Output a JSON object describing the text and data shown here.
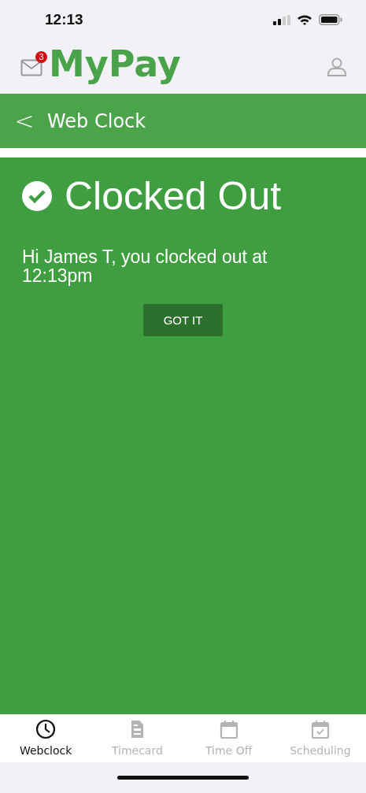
{
  "status_bar": {
    "time": "12:13"
  },
  "header": {
    "logo": "MyPay",
    "mail_badge": "3"
  },
  "nav_bar": {
    "back": "<",
    "title": "Web Clock"
  },
  "notice": {
    "title": "Clocked Out",
    "message": "Hi James T, you clocked out at 12:13pm",
    "button": "GOT IT"
  },
  "tabs": [
    {
      "label": "Webclock",
      "kind": "clock",
      "selected": true
    },
    {
      "label": "Timecard",
      "kind": "document",
      "selected": false
    },
    {
      "label": "Time Off",
      "kind": "calendar",
      "selected": false
    },
    {
      "label": "Scheduling",
      "kind": "calendar-check",
      "selected": false
    }
  ]
}
